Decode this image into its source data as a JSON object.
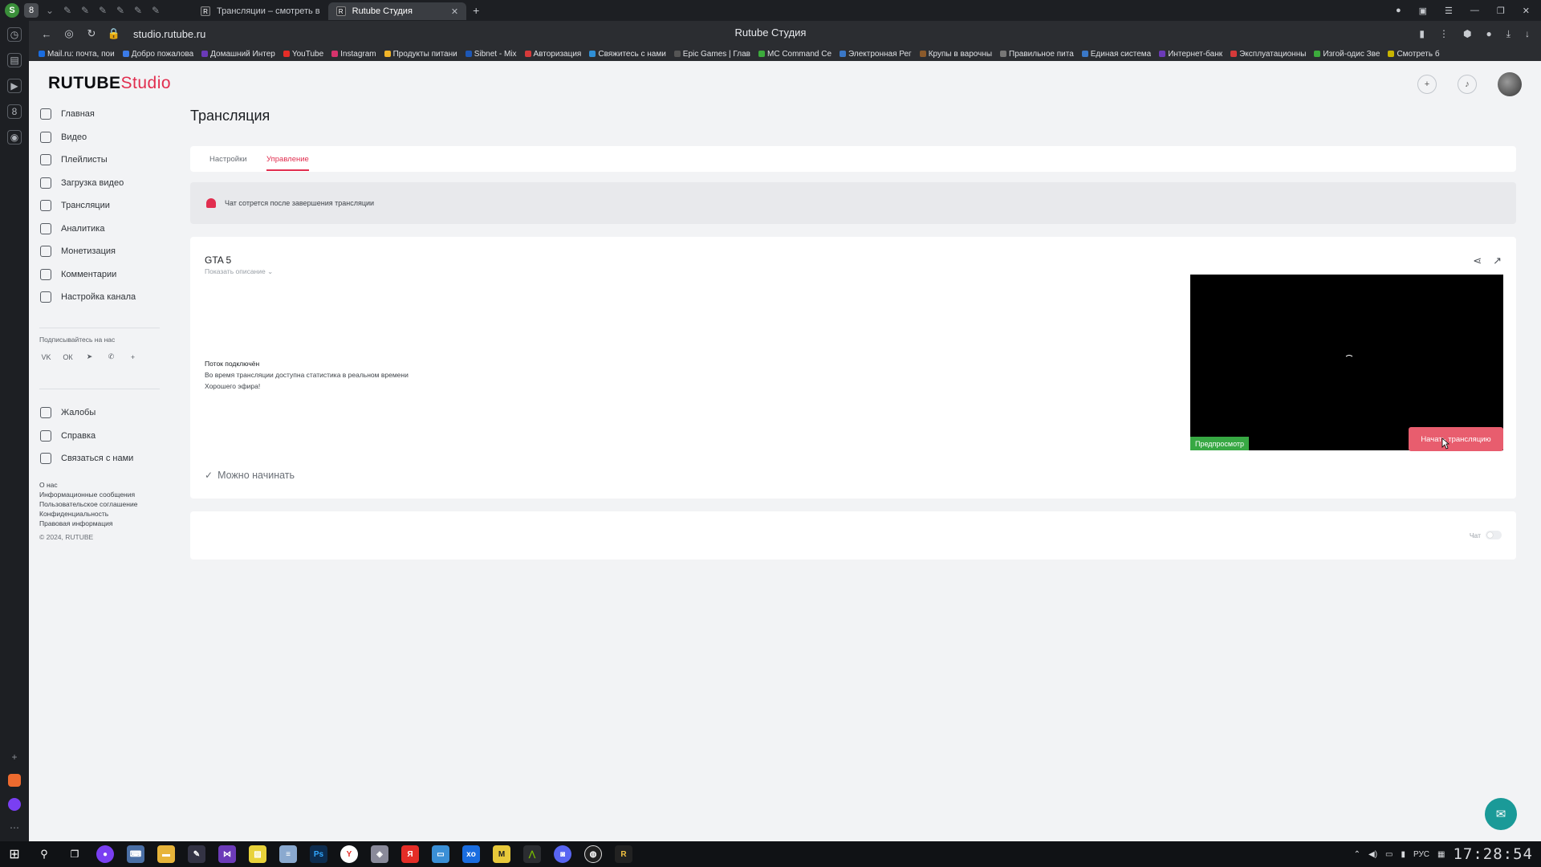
{
  "browser": {
    "tabs": [
      {
        "label": "Трансляции – смотреть в",
        "active": false
      },
      {
        "label": "Rutube Студия",
        "active": true
      }
    ],
    "url": "studio.rutube.ru",
    "page_title": "Rutube Студия",
    "bookmarks": [
      {
        "label": "Mail.ru: почта, пои",
        "color": "#1a6de0"
      },
      {
        "label": "Добро пожалова",
        "color": "#3b7be8"
      },
      {
        "label": "Домашний Интер",
        "color": "#6b3ab8"
      },
      {
        "label": "YouTube",
        "color": "#e52d27"
      },
      {
        "label": "Instagram",
        "color": "#d6336c"
      },
      {
        "label": "Продукты питани",
        "color": "#f0b429"
      },
      {
        "label": "Sibnet - Mix",
        "color": "#1d57b6"
      },
      {
        "label": "Авторизация",
        "color": "#d63a3a"
      },
      {
        "label": "Свяжитесь с нами",
        "color": "#2f8fd6"
      },
      {
        "label": "Epic Games | Глав",
        "color": "#555555"
      },
      {
        "label": "MC Command Ce",
        "color": "#3cab3c"
      },
      {
        "label": "Электронная Рег",
        "color": "#3a78c8"
      },
      {
        "label": "Крупы в варочны",
        "color": "#8b5a2b"
      },
      {
        "label": "Правильное пита",
        "color": "#777777"
      },
      {
        "label": "Единая система",
        "color": "#3a78c8"
      },
      {
        "label": "Интернет-банк",
        "color": "#6b3ab8"
      },
      {
        "label": "Эксплуатационны",
        "color": "#d63a3a"
      },
      {
        "label": "Изгой-одис Зве",
        "color": "#3cab3c"
      },
      {
        "label": "Смотреть б",
        "color": "#c8b400"
      }
    ]
  },
  "app": {
    "logo_main": "RUTUBE",
    "logo_studio": "Studio",
    "nav": [
      {
        "label": "Главная",
        "icon": "home-icon"
      },
      {
        "label": "Видео",
        "icon": "video-icon"
      },
      {
        "label": "Плейлисты",
        "icon": "playlist-icon"
      },
      {
        "label": "Загрузка видео",
        "icon": "upload-icon"
      },
      {
        "label": "Трансляции",
        "icon": "broadcast-icon"
      },
      {
        "label": "Аналитика",
        "icon": "analytics-icon"
      },
      {
        "label": "Монетизация",
        "icon": "monetization-icon"
      },
      {
        "label": "Комментарии",
        "icon": "comments-icon"
      },
      {
        "label": "Настройка канала",
        "icon": "channel-settings-icon"
      }
    ],
    "subscribe_label": "Подписывайтесь на нас",
    "socials": [
      "vk",
      "ok",
      "telegram",
      "viber",
      "+"
    ],
    "nav2": [
      {
        "label": "Жалобы",
        "icon": "flag-icon"
      },
      {
        "label": "Справка",
        "icon": "help-icon"
      },
      {
        "label": "Связаться с нами",
        "icon": "contact-icon"
      }
    ],
    "footer_links": [
      "О нас",
      "Информационные сообщения",
      "Пользовательское соглашение",
      "Конфиденциальность",
      "Правовая информация"
    ],
    "copyright": "© 2024, RUTUBE"
  },
  "content": {
    "page_title": "Трансляция",
    "tabs": [
      {
        "label": "Настройки",
        "active": false
      },
      {
        "label": "Управление",
        "active": true
      }
    ],
    "notice": "Чат сотрется после завершения трансляции",
    "stream": {
      "title": "GTA 5",
      "show_description": "Показать описание ⌄",
      "status_heading": "Поток подключён",
      "status_line1": "Во время трансляции доступна статистика в реальном времени",
      "status_line2": "Хорошего эфира!",
      "ready_label": "Можно начинать",
      "preview_badge": "Предпросмотр",
      "start_button": "Начать трансляцию"
    },
    "chat_label": "Чат",
    "chat_enabled": false
  },
  "taskbar": {
    "lang": "РУС",
    "time": "17:28:54"
  }
}
